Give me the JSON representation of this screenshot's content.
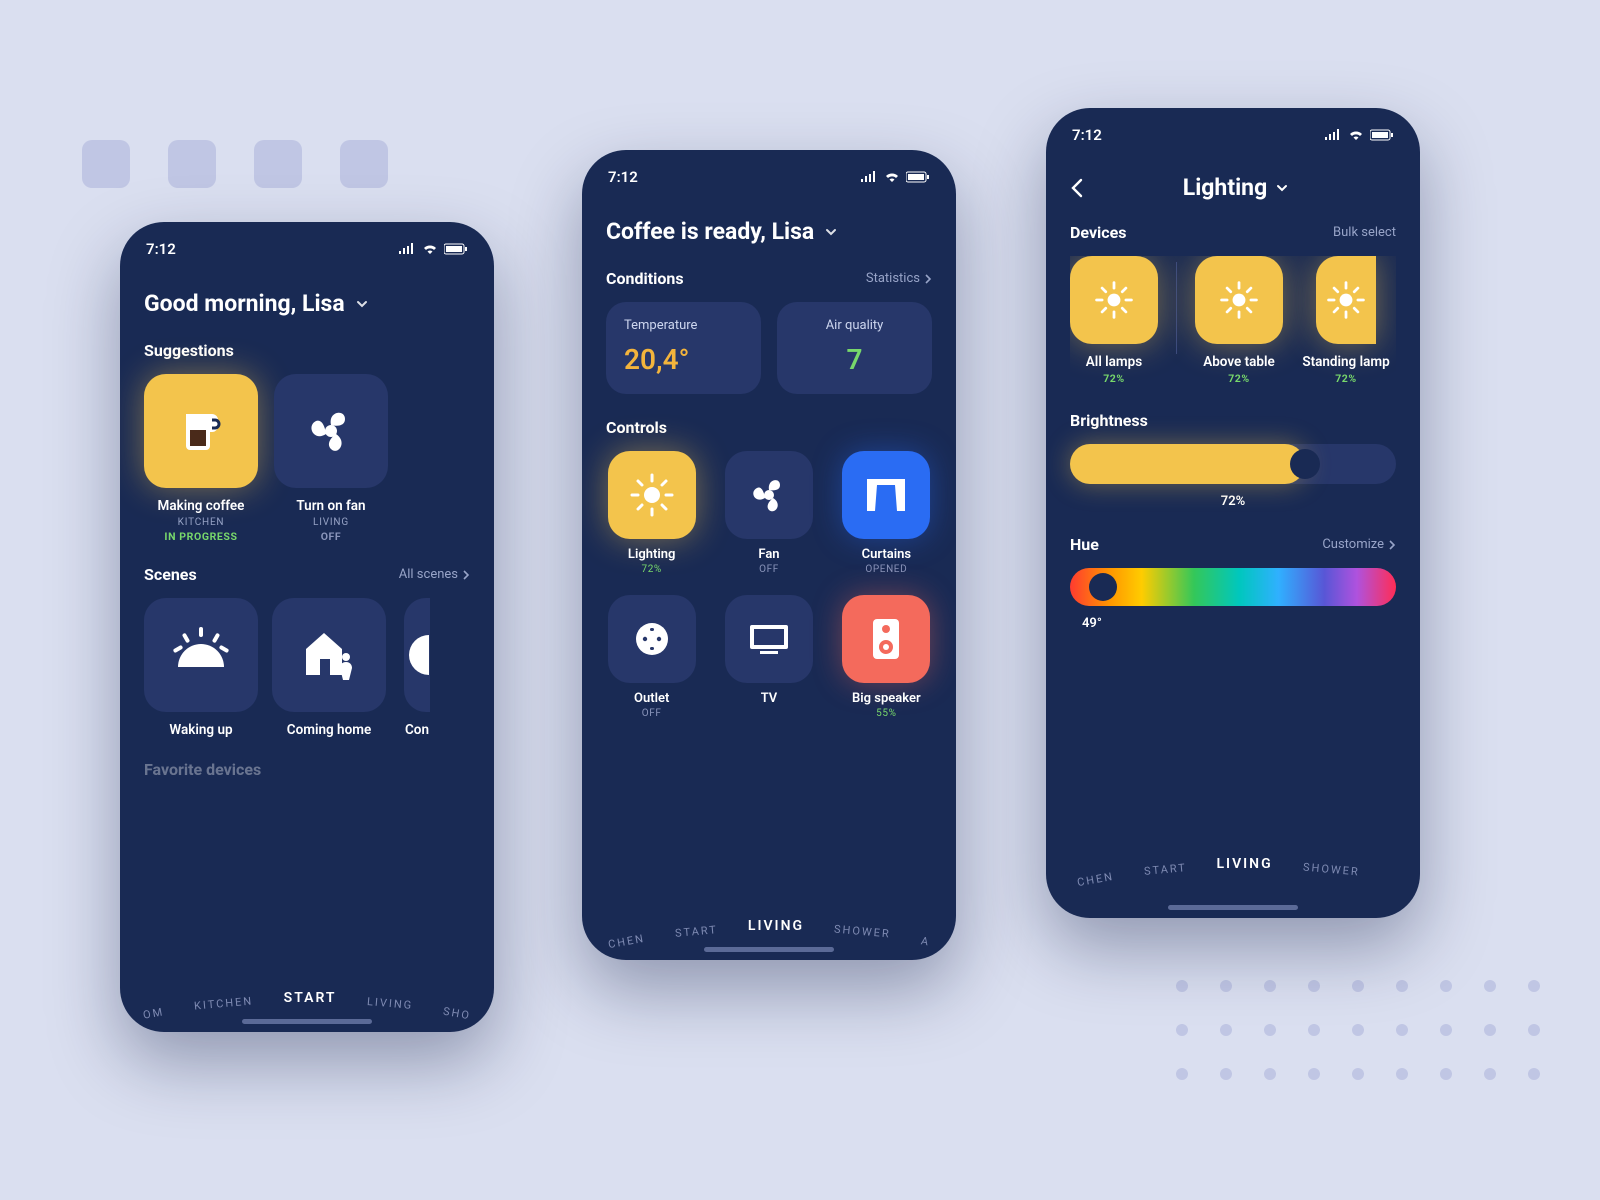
{
  "status_time": "7:12",
  "phone1": {
    "headline": "Good morning, Lisa",
    "suggestions_label": "Suggestions",
    "sugg": [
      {
        "title": "Making coffee",
        "room": "KITCHEN",
        "status": "IN PROGRESS"
      },
      {
        "title": "Turn on fan",
        "room": "LIVING",
        "status": "OFF"
      }
    ],
    "scenes_label": "Scenes",
    "scenes_link": "All scenes",
    "scenes": [
      {
        "title": "Waking up"
      },
      {
        "title": "Coming home"
      },
      {
        "title": "Con"
      }
    ],
    "favorites_label": "Favorite devices",
    "nav": [
      "OM",
      "KITCHEN",
      "START",
      "LIVING",
      "SHO"
    ]
  },
  "phone2": {
    "headline": "Coffee is ready, Lisa",
    "conditions_label": "Conditions",
    "conditions_link": "Statistics",
    "conditions": [
      {
        "label": "Temperature",
        "value": "20,4°"
      },
      {
        "label": "Air quality",
        "value": "7"
      }
    ],
    "controls_label": "Controls",
    "controls": [
      {
        "name": "Lighting",
        "status": "72%",
        "status_green": true
      },
      {
        "name": "Fan",
        "status": "OFF",
        "status_green": false
      },
      {
        "name": "Curtains",
        "status": "OPENED",
        "status_green": false
      },
      {
        "name": "Outlet",
        "status": "OFF",
        "status_green": false
      },
      {
        "name": "TV",
        "status": "",
        "status_green": false
      },
      {
        "name": "Big speaker",
        "status": "55%",
        "status_green": true
      }
    ],
    "nav": [
      "CHEN",
      "START",
      "LIVING",
      "SHOWER",
      "A"
    ]
  },
  "phone3": {
    "title": "Lighting",
    "devices_label": "Devices",
    "bulk_label": "Bulk select",
    "devices": [
      {
        "name": "All lamps",
        "pct": "72%"
      },
      {
        "name": "Above table",
        "pct": "72%"
      },
      {
        "name": "Standing lamp",
        "pct": "72%"
      }
    ],
    "brightness_label": "Brightness",
    "brightness_value": "72%",
    "brightness_pct": 72,
    "hue_label": "Hue",
    "hue_link": "Customize",
    "hue_value": "49°",
    "hue_pct": 10,
    "nav": [
      "CHEN",
      "START",
      "LIVING",
      "SHOWER",
      ""
    ]
  }
}
